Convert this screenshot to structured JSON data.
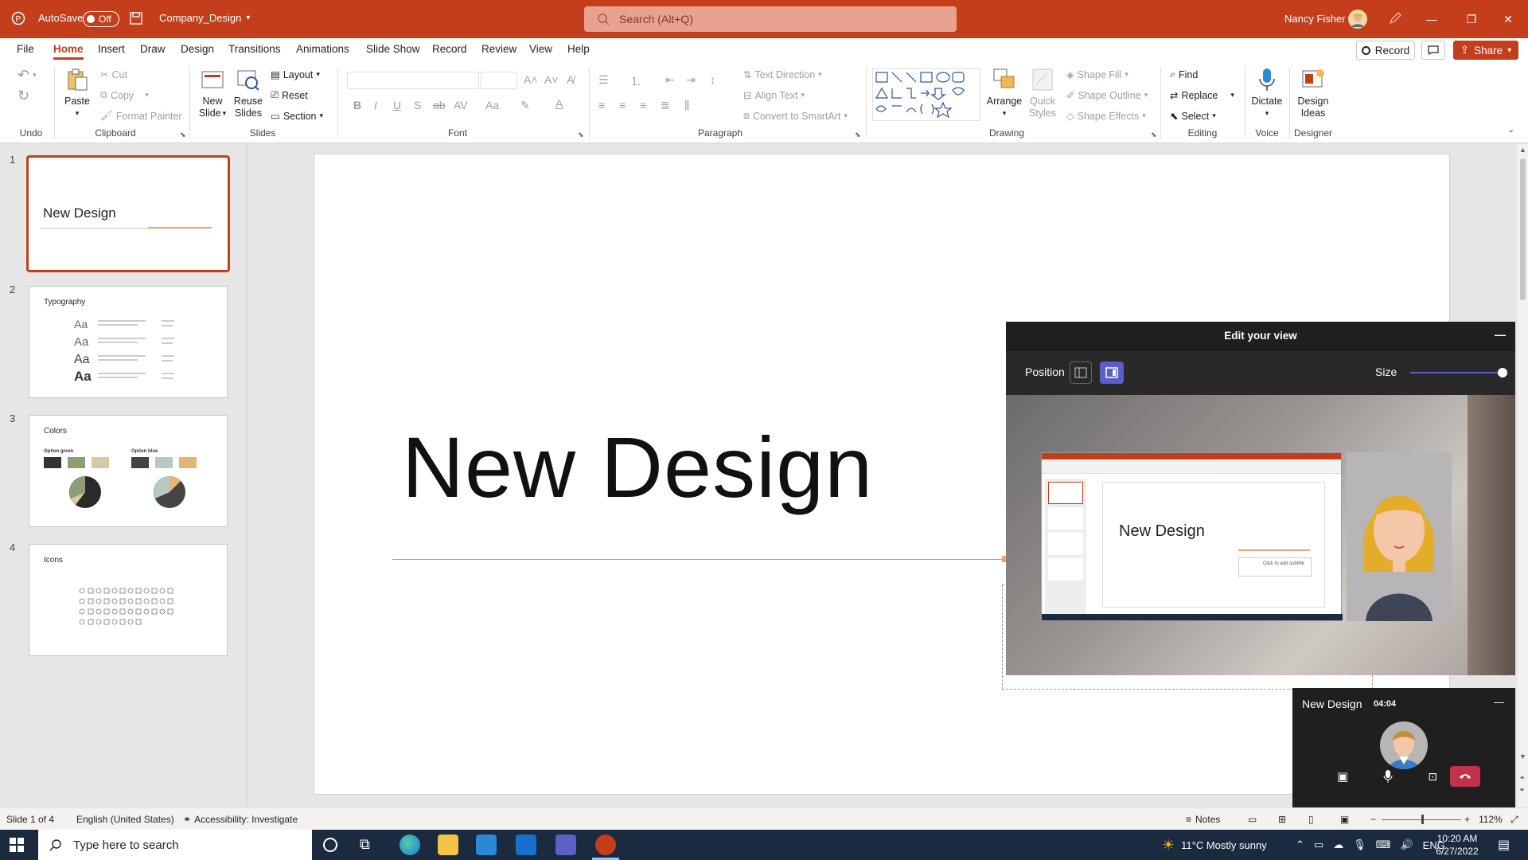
{
  "titlebar": {
    "autosave_label": "AutoSave",
    "autosave_state": "Off",
    "doc_name": "Company_Design",
    "search_placeholder": "Search (Alt+Q)",
    "user_name": "Nancy Fisher"
  },
  "menu": {
    "tabs": [
      "File",
      "Home",
      "Insert",
      "Draw",
      "Design",
      "Transitions",
      "Animations",
      "Slide Show",
      "Record",
      "Review",
      "View",
      "Help"
    ],
    "active_tab": "Home",
    "record_button": "Record",
    "share_button": "Share"
  },
  "ribbon": {
    "groups": {
      "undo": "Undo",
      "clipboard": "Clipboard",
      "slides": "Slides",
      "font": "Font",
      "paragraph": "Paragraph",
      "drawing": "Drawing",
      "editing": "Editing",
      "voice": "Voice",
      "designer": "Designer"
    },
    "paste": "Paste",
    "cut": "Cut",
    "copy": "Copy",
    "format_painter": "Format Painter",
    "new_slide": "New\nSlide",
    "new_slide_l1": "New",
    "new_slide_l2": "Slide",
    "reuse_l1": "Reuse",
    "reuse_l2": "Slides",
    "layout": "Layout",
    "reset": "Reset",
    "section": "Section",
    "text_direction": "Text Direction",
    "align_text": "Align Text",
    "convert_smartart": "Convert to SmartArt",
    "arrange": "Arrange",
    "quick_styles_l1": "Quick",
    "quick_styles_l2": "Styles",
    "shape_fill": "Shape Fill",
    "shape_outline": "Shape Outline",
    "shape_effects": "Shape Effects",
    "find": "Find",
    "replace": "Replace",
    "select": "Select",
    "dictate": "Dictate",
    "design_ideas_l1": "Design",
    "design_ideas_l2": "Ideas"
  },
  "thumbnails": [
    {
      "num": "1",
      "title": "New Design"
    },
    {
      "num": "2",
      "title": "Typography"
    },
    {
      "num": "3",
      "title": "Colors",
      "opt1": "Option green",
      "opt2": "Option blue"
    },
    {
      "num": "4",
      "title": "Icons"
    }
  ],
  "slide": {
    "title": "New Design"
  },
  "edit_view": {
    "header": "Edit your view",
    "position_label": "Position",
    "size_label": "Size",
    "size_value": 1.0,
    "preview_title": "New Design",
    "preview_subtitle": "Click to add subtitle"
  },
  "meeting": {
    "title": "New Design",
    "timer": "04:04"
  },
  "statusbar": {
    "slide_info": "Slide 1 of 4",
    "language": "English (United States)",
    "accessibility": "Accessibility: Investigate",
    "notes": "Notes",
    "zoom": "112%"
  },
  "taskbar": {
    "search_placeholder": "Type here to search",
    "weather": "11°C  Mostly sunny",
    "lang": "ENG",
    "time": "10:20 AM",
    "date": "6/27/2022"
  },
  "colors": {
    "accent": "#c43e1c",
    "panel_dark": "#1f1f1f",
    "taskbar": "#1b2a3e",
    "hangup": "#c4314b"
  }
}
